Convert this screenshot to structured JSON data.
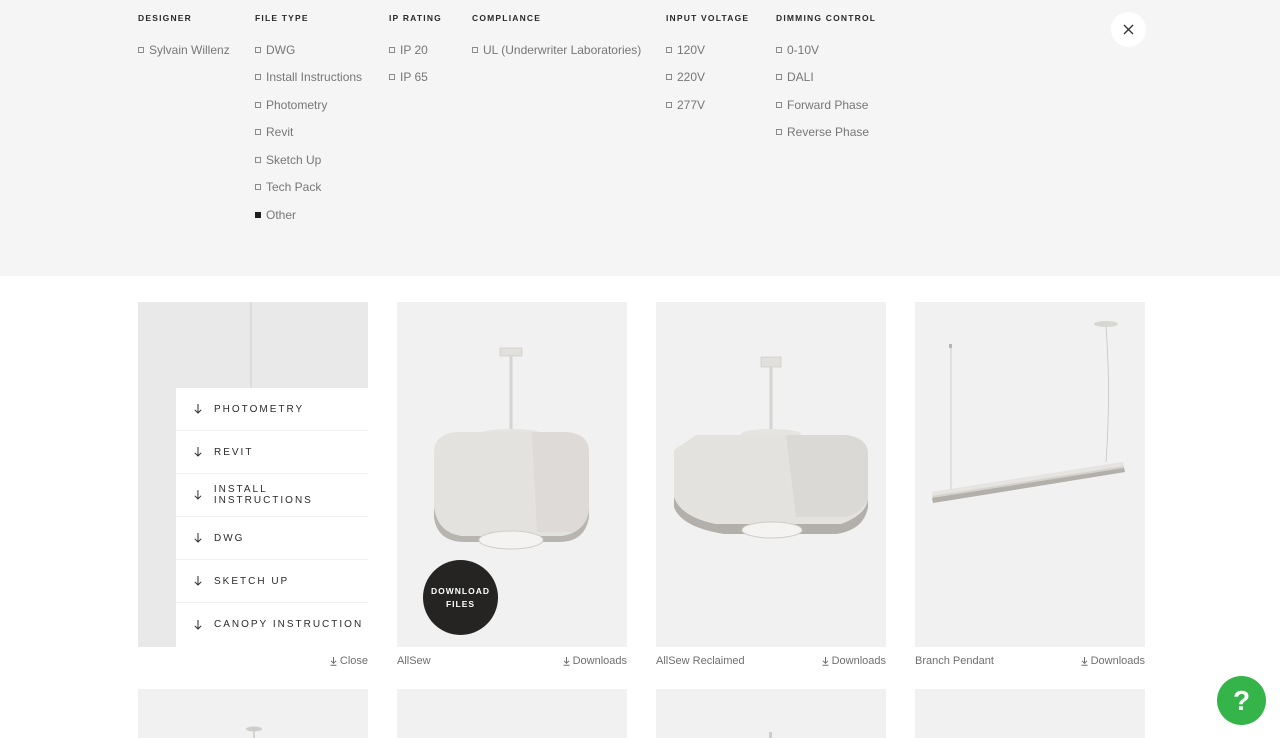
{
  "filters": [
    {
      "heading": "DESIGNER",
      "options": [
        {
          "label": "Sylvain Willenz",
          "checked": false
        }
      ]
    },
    {
      "heading": "FILE TYPE",
      "options": [
        {
          "label": "DWG",
          "checked": false
        },
        {
          "label": "Install Instructions",
          "checked": false
        },
        {
          "label": "Photometry",
          "checked": false
        },
        {
          "label": "Revit",
          "checked": false
        },
        {
          "label": "Sketch Up",
          "checked": false
        },
        {
          "label": "Tech Pack",
          "checked": false
        },
        {
          "label": "Other",
          "checked": true
        }
      ]
    },
    {
      "heading": "IP RATING",
      "options": [
        {
          "label": "IP 20",
          "checked": false
        },
        {
          "label": "IP 65",
          "checked": false
        }
      ]
    },
    {
      "heading": "COMPLIANCE",
      "options": [
        {
          "label": "UL (Underwriter Laboratories)",
          "checked": false
        }
      ]
    },
    {
      "heading": "INPUT VOLTAGE",
      "options": [
        {
          "label": "120V",
          "checked": false
        },
        {
          "label": "220V",
          "checked": false
        },
        {
          "label": "277V",
          "checked": false
        }
      ]
    },
    {
      "heading": "DIMMING CONTROL",
      "options": [
        {
          "label": "0-10V",
          "checked": false
        },
        {
          "label": "DALI",
          "checked": false
        },
        {
          "label": "Forward Phase",
          "checked": false
        },
        {
          "label": "Reverse Phase",
          "checked": false
        }
      ]
    }
  ],
  "close_icon": "close-icon",
  "downloads_menu": {
    "items": [
      "PHOTOMETRY",
      "REVIT",
      "INSTALL INSTRUCTIONS",
      "DWG",
      "SKETCH UP",
      "CANOPY INSTRUCTION"
    ],
    "close_label": "Close"
  },
  "download_files_button": {
    "line1": "DOWNLOAD",
    "line2": "FILES"
  },
  "products": [
    {
      "name": "AllSew",
      "downloads_label": "Downloads"
    },
    {
      "name": "AllSew Reclaimed",
      "downloads_label": "Downloads"
    },
    {
      "name": "Branch Pendant",
      "downloads_label": "Downloads"
    }
  ],
  "help_button": {
    "label": "?"
  },
  "colors": {
    "panel_bg": "#f5f5f5",
    "card_bg": "#f1f1f1",
    "help_green": "#35b44a",
    "dark_button": "#252422"
  }
}
